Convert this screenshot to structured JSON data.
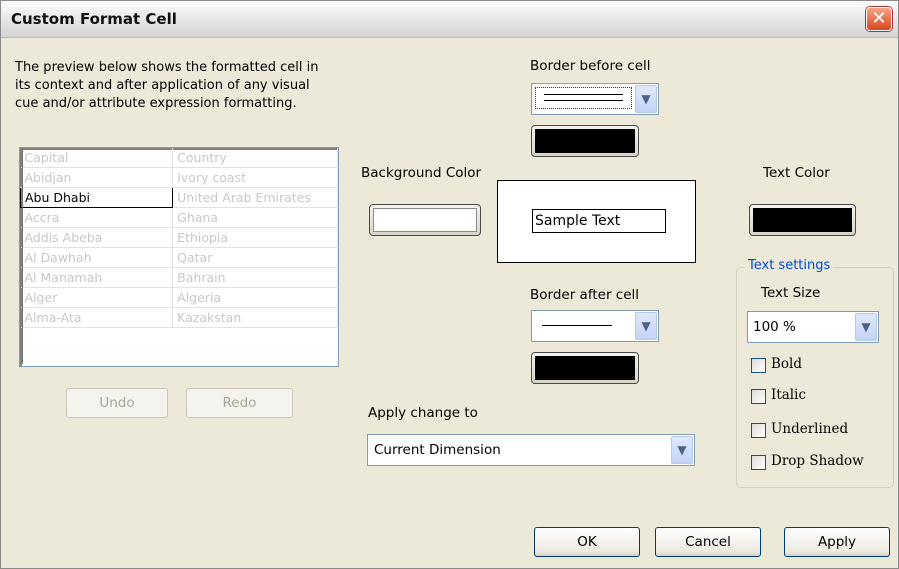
{
  "window": {
    "title": "Custom Format Cell",
    "close_glyph": "✕"
  },
  "description": "The preview below shows the formatted cell in\nits context and after application of any visual\ncue and/or attribute expression formatting.",
  "preview": {
    "rows": [
      [
        "Capital",
        "Country"
      ],
      [
        "Abidjan",
        "Ivory coast"
      ],
      [
        "Abu Dhabi",
        "United Arab Emirates"
      ],
      [
        "Accra",
        "Ghana"
      ],
      [
        "Addis Abeba",
        "Ethiopia"
      ],
      [
        "Al Dawhah",
        "Qatar"
      ],
      [
        "Al Manamah",
        "Bahrain"
      ],
      [
        "Alger",
        "Algeria"
      ],
      [
        "Alma-Ata",
        "Kazakstan"
      ]
    ],
    "selected_cell": "Abu Dhabi"
  },
  "undo_label": "Undo",
  "redo_label": "Redo",
  "border_before": {
    "label": "Border before cell",
    "color": "#000000"
  },
  "border_after": {
    "label": "Border after cell",
    "color": "#000000"
  },
  "background": {
    "label": "Background Color",
    "color": "#ffffff"
  },
  "sample_text": "Sample Text",
  "text_color": {
    "label": "Text Color",
    "color": "#000000"
  },
  "apply_change": {
    "label": "Apply change to",
    "value": "Current Dimension"
  },
  "text_settings": {
    "title": "Text settings",
    "size_label": "Text Size",
    "size_value": "100 %",
    "bold": "Bold",
    "italic": "Italic",
    "underlined": "Underlined",
    "drop_shadow": "Drop Shadow"
  },
  "buttons": {
    "ok": "OK",
    "cancel": "Cancel",
    "apply": "Apply"
  },
  "icons": {
    "dropdown": "chevron-down-icon",
    "close": "close-icon"
  }
}
